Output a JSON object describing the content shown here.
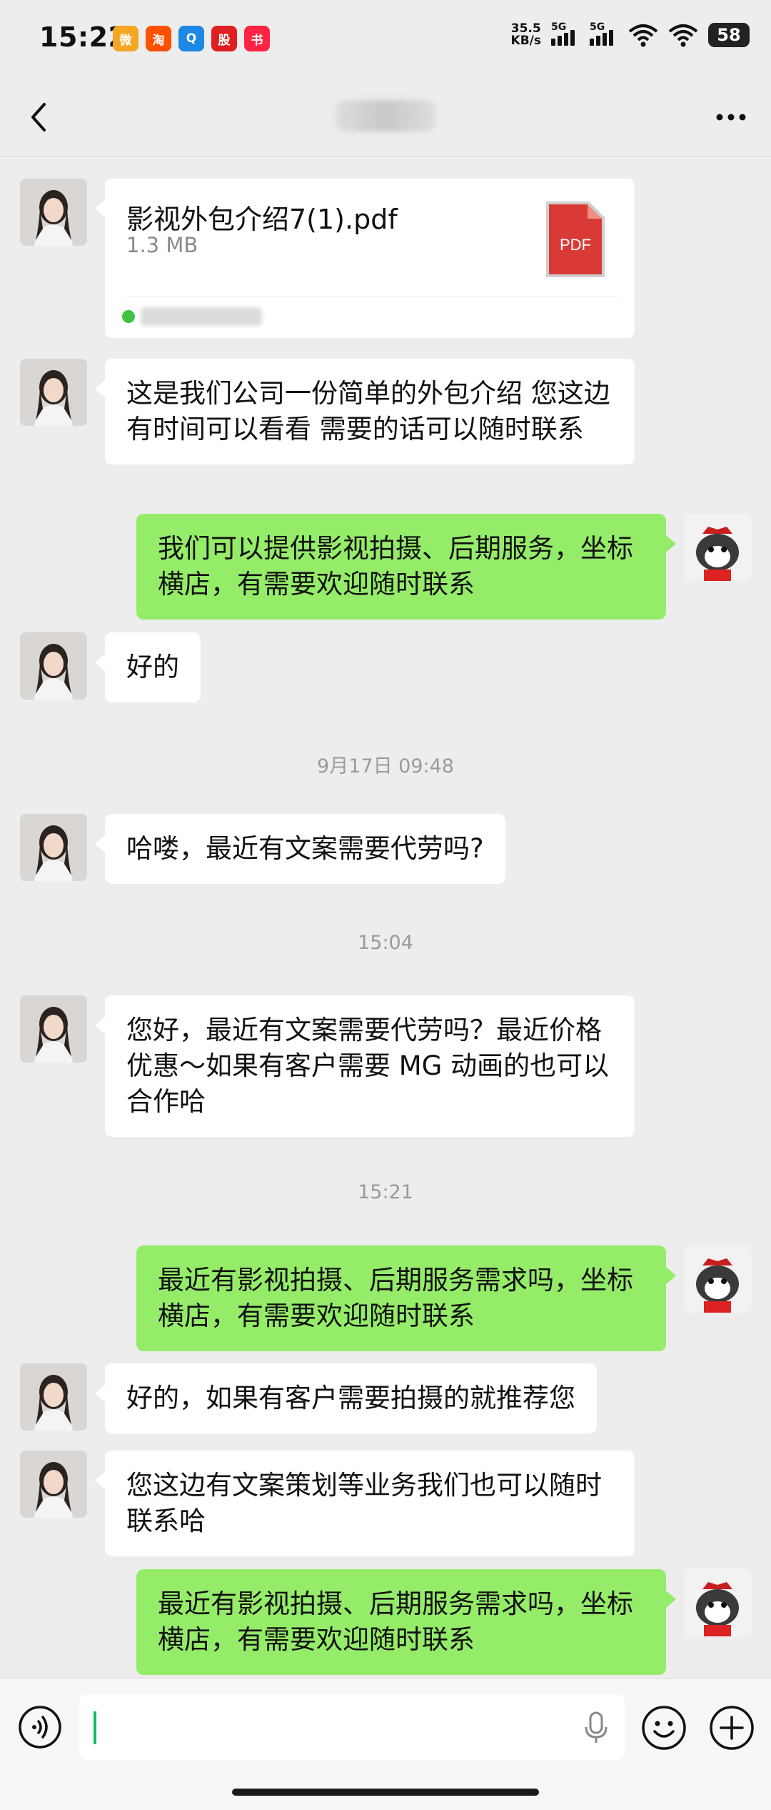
{
  "status_bar": {
    "time": "15:22",
    "apps": [
      {
        "icon": "weibo-icon",
        "color": "#f5a623",
        "glyph": "微"
      },
      {
        "icon": "taobao-icon",
        "color": "#ff5000",
        "glyph": "淘"
      },
      {
        "icon": "qq-browser-icon",
        "color": "#1e88e5",
        "glyph": "Q"
      },
      {
        "icon": "stock-app-icon",
        "color": "#e02020",
        "glyph": "股"
      },
      {
        "icon": "xiaohongshu-icon",
        "color": "#ff2442",
        "glyph": "书"
      }
    ],
    "net_speed_value": "35.5",
    "net_speed_unit": "KB/s",
    "sim1_label": "5G",
    "sim2_label": "5G",
    "battery": "58"
  },
  "nav": {
    "title": ""
  },
  "file_message": {
    "name": "影视外包介绍7(1).pdf",
    "size": "1.3 MB",
    "icon_label": "PDF"
  },
  "messages": {
    "m1": "这是我们公司一份简单的外包介绍 您这边有时间可以看看 需要的话可以随时联系",
    "m2": "我们可以提供影视拍摄、后期服务，坐标横店，有需要欢迎随时联系",
    "m3": "好的",
    "ts1": "9月17日 09:48",
    "m4": "哈喽，最近有文案需要代劳吗?",
    "ts2": "15:04",
    "m5": "您好，最近有文案需要代劳吗？最近价格优惠～如果有客户需要 MG 动画的也可以合作哈",
    "ts3": "15:21",
    "m6": "最近有影视拍摄、后期服务需求吗，坐标横店，有需要欢迎随时联系",
    "m7": "好的，如果有客户需要拍摄的就推荐您",
    "m8": "您这边有文案策划等业务我们也可以随时联系哈",
    "m9": "最近有影视拍摄、后期服务需求吗，坐标横店，有需要欢迎随时联系"
  },
  "input": {
    "value": ""
  },
  "colors": {
    "bubble_me": "#95ec69",
    "bubble_other": "#ffffff",
    "background": "#ededed",
    "pdf_red": "#d93a35"
  }
}
